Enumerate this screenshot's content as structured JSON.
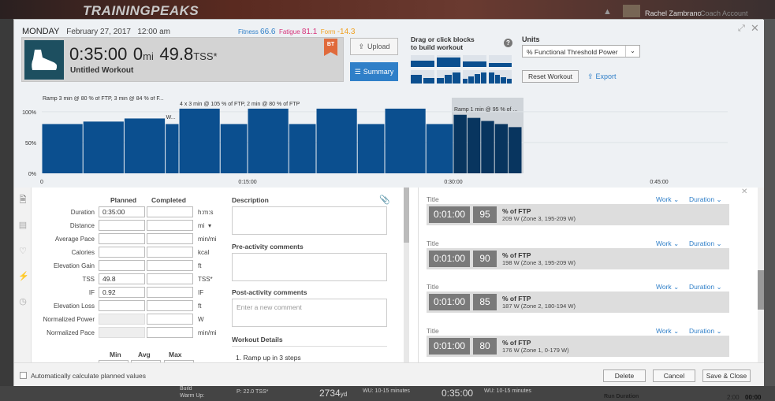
{
  "app": {
    "logo": "TRAININGPEAKS",
    "user": "Rachel Zambrano",
    "account": "Coach Account"
  },
  "header": {
    "day": "MONDAY",
    "date": "February 27, 2017",
    "time": "12:00 am",
    "fitness_label": "Fitness",
    "fitness": "66.6",
    "fatigue_label": "Fatigue",
    "fatigue": "81.1",
    "form_label": "Form",
    "form": "-14.3",
    "duration": "0:35:00",
    "distance": "0",
    "distance_unit": "mi",
    "tss": "49.8",
    "tss_unit": "TSS*",
    "title": "Untitled Workout",
    "badge": "BT",
    "upload_label": "Upload",
    "summary_label": "Summary",
    "drag_text_1": "Drag or click blocks",
    "drag_text_2": "to build workout",
    "units_label": "Units",
    "units_value": "% Functional Threshold Power",
    "reset_label": "Reset Workout",
    "export_label": "Export",
    "colors": {
      "accent": "#2f7fc8",
      "fitness": "#2f7fc8",
      "fatigue": "#d6337a",
      "form": "#f0a020",
      "bar": "#0b4f8f",
      "bar_dark": "#08355f"
    }
  },
  "chart_data": {
    "type": "bar",
    "ylabels": [
      "100%",
      "50%",
      "0%"
    ],
    "xlabels": [
      "0",
      "0:15:00",
      "0:30:00",
      "0:45:00"
    ],
    "annotations": [
      "Ramp 3 min @ 80 % of FTP, 3 min @ 84 % of F...",
      "W...",
      "4 x 3 min @ 105 % of FTP, 2 min @ 80 % of FTP",
      "Ramp 1 min @ 95 % of ..."
    ],
    "blocks": [
      {
        "start": 0,
        "dur": 3,
        "pct": 80,
        "group": 0
      },
      {
        "start": 3,
        "dur": 3,
        "pct": 84,
        "group": 0
      },
      {
        "start": 6,
        "dur": 3,
        "pct": 89,
        "group": 0
      },
      {
        "start": 9,
        "dur": 1,
        "pct": 80,
        "group": 1
      },
      {
        "start": 10,
        "dur": 3,
        "pct": 105,
        "group": 2
      },
      {
        "start": 13,
        "dur": 2,
        "pct": 80,
        "group": 2
      },
      {
        "start": 15,
        "dur": 3,
        "pct": 105,
        "group": 2
      },
      {
        "start": 18,
        "dur": 2,
        "pct": 80,
        "group": 2
      },
      {
        "start": 20,
        "dur": 3,
        "pct": 105,
        "group": 2
      },
      {
        "start": 23,
        "dur": 2,
        "pct": 80,
        "group": 2
      },
      {
        "start": 25,
        "dur": 3,
        "pct": 105,
        "group": 2
      },
      {
        "start": 28,
        "dur": 2,
        "pct": 80,
        "group": 2
      },
      {
        "start": 30,
        "dur": 1,
        "pct": 95,
        "group": 3
      },
      {
        "start": 31,
        "dur": 1,
        "pct": 90,
        "group": 3
      },
      {
        "start": 32,
        "dur": 1,
        "pct": 85,
        "group": 3
      },
      {
        "start": 33,
        "dur": 1,
        "pct": 80,
        "group": 3
      },
      {
        "start": 34,
        "dur": 1,
        "pct": 75,
        "group": 3
      }
    ],
    "xmax": 50,
    "ymax": 110,
    "selected_group": 3
  },
  "form": {
    "planned_hdr": "Planned",
    "completed_hdr": "Completed",
    "rows": [
      {
        "label": "Duration",
        "planned": "0:35:00",
        "unit": "h:m:s"
      },
      {
        "label": "Distance",
        "planned": "",
        "unit": "mi"
      },
      {
        "label": "Average Pace",
        "planned": "",
        "unit": "min/mi"
      },
      {
        "label": "Calories",
        "planned": "",
        "unit": "kcal"
      },
      {
        "label": "Elevation Gain",
        "planned": "",
        "unit": "ft"
      },
      {
        "label": "TSS",
        "planned": "49.8",
        "unit": "TSS*"
      },
      {
        "label": "IF",
        "planned": "0.92",
        "unit": "IF"
      },
      {
        "label": "Elevation Loss",
        "planned": "",
        "unit": "ft"
      },
      {
        "label": "Normalized Power",
        "planned": "",
        "unit": "W"
      },
      {
        "label": "Normalized Pace",
        "planned": "",
        "unit": "min/mi"
      }
    ],
    "min_hdr": "Min",
    "avg_hdr": "Avg",
    "max_hdr": "Max"
  },
  "comments": {
    "description_label": "Description",
    "pre_label": "Pre-activity comments",
    "post_label": "Post-activity comments",
    "post_placeholder": "Enter a new comment",
    "details_label": "Workout Details",
    "details_item": "1. Ramp up in 3 steps"
  },
  "steps": [
    {
      "title": "Title",
      "work": "Work",
      "duration_lbl": "Duration",
      "time": "0:01:00",
      "pct": "95",
      "unit": "% of FTP",
      "zone": "209 W (Zone 3, 195-209 W)"
    },
    {
      "title": "Title",
      "work": "Work",
      "duration_lbl": "Duration",
      "time": "0:01:00",
      "pct": "90",
      "unit": "% of FTP",
      "zone": "198 W (Zone 3, 195-209 W)"
    },
    {
      "title": "Title",
      "work": "Work",
      "duration_lbl": "Duration",
      "time": "0:01:00",
      "pct": "85",
      "unit": "% of FTP",
      "zone": "187 W (Zone 2, 180-194 W)"
    },
    {
      "title": "Title",
      "work": "Work",
      "duration_lbl": "Duration",
      "time": "0:01:00",
      "pct": "80",
      "unit": "% of FTP",
      "zone": "176 W (Zone 1, 0-179 W)"
    }
  ],
  "footer": {
    "auto_calc": "Automatically calculate planned values",
    "delete": "Delete",
    "cancel": "Cancel",
    "save_close": "Save & Close"
  },
  "bottom": {
    "build": "Build",
    "warmup": "Warm Up:",
    "tss": "P: 22.0 TSS*",
    "yd": "2734",
    "yd_unit": "yd",
    "wu1": "WU: 10-15 minutes",
    "time": "0:35:00",
    "wu2": "WU: 10-15 minutes",
    "run_dur": "Run Duration",
    "run_val1": "2:00",
    "run_val2": "00:00"
  }
}
